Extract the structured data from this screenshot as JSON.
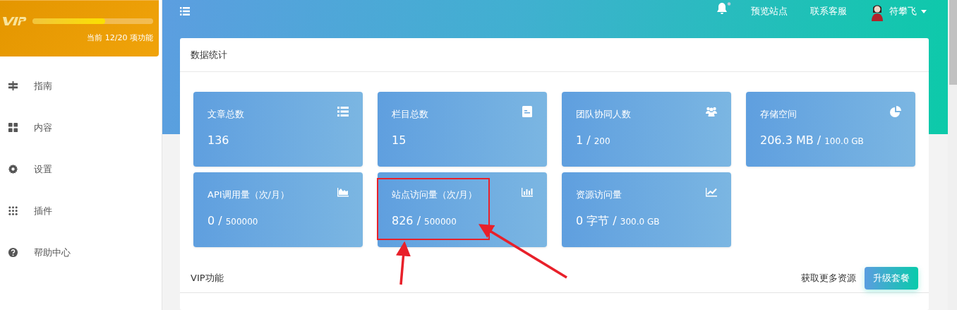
{
  "vip": {
    "level": 0.6,
    "progress_text": "当前 12/20 项功能"
  },
  "sidebar": {
    "items": [
      {
        "label": "指南",
        "kind": "signs"
      },
      {
        "label": "内容",
        "kind": "grid"
      },
      {
        "label": "设置",
        "kind": "gear"
      },
      {
        "label": "插件",
        "kind": "dots"
      },
      {
        "label": "帮助中心",
        "kind": "help"
      }
    ]
  },
  "topbar": {
    "links": [
      "预览站点",
      "联系客服"
    ],
    "user": "符攀飞"
  },
  "panel": {
    "title": "数据统计",
    "stats": [
      {
        "title": "文章总数",
        "value": "136",
        "kind": "list"
      },
      {
        "title": "栏目总数",
        "value": "15",
        "kind": "doc"
      },
      {
        "title": "团队协同人数",
        "value": "1 /",
        "limit": "200",
        "kind": "users"
      },
      {
        "title": "存储空间",
        "value": "206.3 MB /",
        "limit": "100.0 GB",
        "kind": "pie"
      },
      {
        "title": "API调用量（次/月）",
        "value": "0 /",
        "limit": "500000",
        "kind": "area"
      },
      {
        "title": "站点访问量（次/月）",
        "value": "826 /",
        "limit": "500000",
        "kind": "bars"
      },
      {
        "title": "资源访问量",
        "value": "0 字节 /",
        "limit": "300.0 GB",
        "kind": "line"
      }
    ],
    "vip_section": {
      "title": "VIP功能",
      "link": "获取更多资源",
      "button": "升级套餐"
    }
  }
}
